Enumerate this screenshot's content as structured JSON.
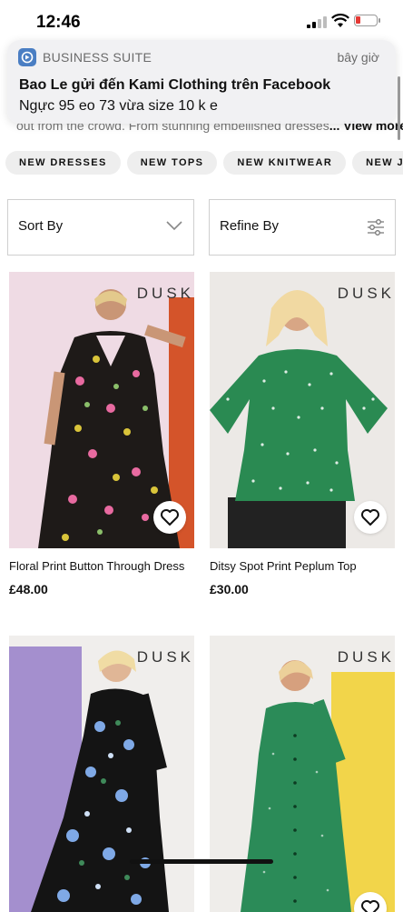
{
  "status_bar": {
    "time": "12:46"
  },
  "notification": {
    "app_name": "BUSINESS SUITE",
    "time": "bây giờ",
    "title": "Bao Le gửi đến Kami Clothing trên Facebook",
    "body": "Ngực 95 eo 73 vừa size 10 k e"
  },
  "category": {
    "description_peek": "out from the crowd. From stunning embellished dresses",
    "view_more": "... View more"
  },
  "chips": [
    "NEW DRESSES",
    "NEW TOPS",
    "NEW KNITWEAR",
    "NEW JA"
  ],
  "filters": {
    "sort_label": "Sort By",
    "refine_label": "Refine By"
  },
  "products": [
    {
      "brand": "DUSK",
      "name": "Floral Print Button Through Dress",
      "price": "£48.00"
    },
    {
      "brand": "DUSK",
      "name": "Ditsy Spot Print Peplum Top",
      "price": "£30.00"
    },
    {
      "brand": "DUSK",
      "name": "",
      "price": ""
    },
    {
      "brand": "DUSK",
      "name": "",
      "price": ""
    }
  ],
  "colors": {
    "notification_bg": "#f0f0f2",
    "chip_bg": "#eeeeee",
    "battery_low": "#e53935",
    "app_icon": "#4a7ec3"
  },
  "icons": {
    "sort": "chevron-down-icon",
    "refine": "sliders-icon",
    "favourite": "heart-icon"
  }
}
